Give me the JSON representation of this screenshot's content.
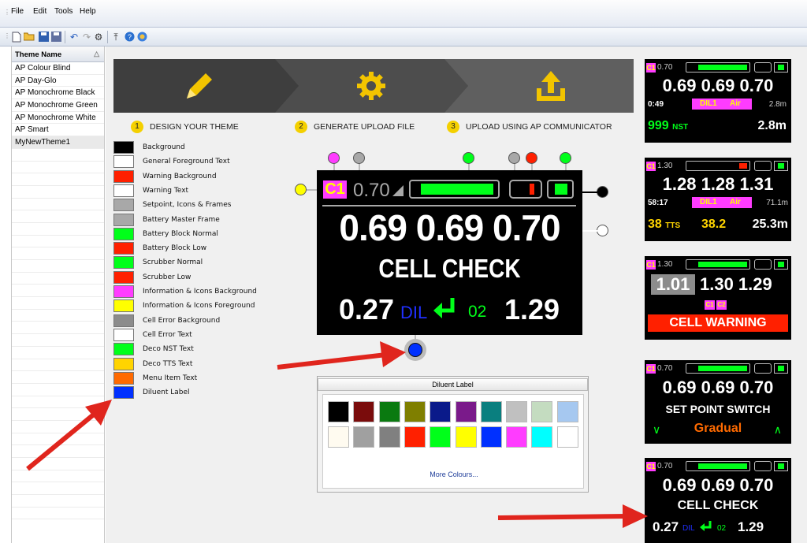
{
  "menu": {
    "items": [
      "File",
      "Edit",
      "Tools",
      "Help"
    ]
  },
  "toolbar": {
    "icons": [
      "new-file-icon",
      "open-folder-icon",
      "save-icon",
      "save-as-icon",
      "undo-icon",
      "redo-icon",
      "settings-gear-icon",
      "upload-icon",
      "help-icon",
      "info-icon"
    ]
  },
  "sidebar": {
    "header": "Theme Name",
    "sort_icon": "△",
    "themes": [
      "AP Colour Blind",
      "AP Day-Glo",
      "AP Monochrome Black",
      "AP Monochrome Green",
      "AP Monochrome White",
      "AP Smart",
      "MyNewTheme1"
    ],
    "selected_index": 6
  },
  "steps": [
    {
      "num": "1",
      "label": "DESIGN YOUR THEME",
      "icon": "pencil-icon"
    },
    {
      "num": "2",
      "label": "GENERATE UPLOAD FILE",
      "icon": "gear-icon"
    },
    {
      "num": "3",
      "label": "UPLOAD USING AP COMMUNICATOR",
      "icon": "upload-icon"
    }
  ],
  "legend": [
    {
      "label": "Background",
      "color": "#000000"
    },
    {
      "label": "General Foreground Text",
      "color": "#ffffff"
    },
    {
      "label": "Warning Background",
      "color": "#ff2000"
    },
    {
      "label": "Warning Text",
      "color": "#ffffff"
    },
    {
      "label": "Setpoint, Icons & Frames",
      "color": "#a8a8a8"
    },
    {
      "label": "Battery Master Frame",
      "color": "#a8a8a8"
    },
    {
      "label": "Battery Block Normal",
      "color": "#00ff1a"
    },
    {
      "label": "Battery Block Low",
      "color": "#ff2000"
    },
    {
      "label": "Scrubber Normal",
      "color": "#00ff1a"
    },
    {
      "label": "Scrubber Low",
      "color": "#ff2000"
    },
    {
      "label": "Information & Icons Background",
      "color": "#ff3cff"
    },
    {
      "label": "Information & Icons Foreground",
      "color": "#ffff00"
    },
    {
      "label": "Cell Error Background",
      "color": "#8c8c8c"
    },
    {
      "label": "Cell Error Text",
      "color": "#ffffff"
    },
    {
      "label": "Deco NST Text",
      "color": "#00ff1a"
    },
    {
      "label": "Deco TTS Text",
      "color": "#ffd400"
    },
    {
      "label": "Menu Item Text",
      "color": "#ff6a00"
    },
    {
      "label": "Diluent Label",
      "color": "#0030ff"
    }
  ],
  "device": {
    "badge": "C1",
    "setpoint": "0.70",
    "cells": [
      "0.69",
      "0.69",
      "0.70"
    ],
    "status": "CELL CHECK",
    "dil_value": "0.27",
    "dil_label": "DIL",
    "o2_label": "02",
    "o2_value": "1.29"
  },
  "palette": {
    "title": "Diluent Label",
    "row1": [
      "#000000",
      "#7a0c0c",
      "#0a7a10",
      "#7f7f00",
      "#0a1a8a",
      "#7a1a8a",
      "#0a7f7f",
      "#c0c0c0",
      "#c4dcc0",
      "#a6c8f0"
    ],
    "row2": [
      "#fffbf0",
      "#a0a0a0",
      "#808080",
      "#ff2000",
      "#00ff1a",
      "#ffff00",
      "#0030ff",
      "#ff3cff",
      "#00ffff",
      "#ffffff"
    ],
    "more": "More Colours..."
  },
  "previews": [
    {
      "badge": "C1",
      "sp": "0.70",
      "cells": "0.69 0.69 0.70",
      "time": "0:49",
      "gas1": "DIL1",
      "gas2": "Air",
      "depth_small": "2.8m",
      "nst": "999",
      "nst_unit": "NST",
      "depth": "2.8m"
    },
    {
      "badge": "C1",
      "sp": "1.30",
      "cells": "1.28 1.28 1.31",
      "time": "58:17",
      "gas1": "DIL1",
      "gas2": "Air",
      "depth_small": "71.1m",
      "tts": "38",
      "tts_unit": "TTS",
      "tts2": "38.2",
      "depth": "25.3m"
    },
    {
      "badge": "C1",
      "sp": "1.30",
      "cell_err": "1.01",
      "cells": "1.30 1.29",
      "b1": "C1",
      "b2": "C2",
      "warning": "CELL WARNING"
    },
    {
      "badge": "C1",
      "sp": "0.70",
      "cells": "0.69 0.69 0.70",
      "title": "SET POINT SWITCH",
      "mode": "Gradual"
    },
    {
      "badge": "C1",
      "sp": "0.70",
      "cells": "0.69 0.69 0.70",
      "title": "CELL CHECK",
      "dil": "0.27",
      "dil_label": "DIL",
      "o2": "02",
      "o2v": "1.29"
    }
  ]
}
